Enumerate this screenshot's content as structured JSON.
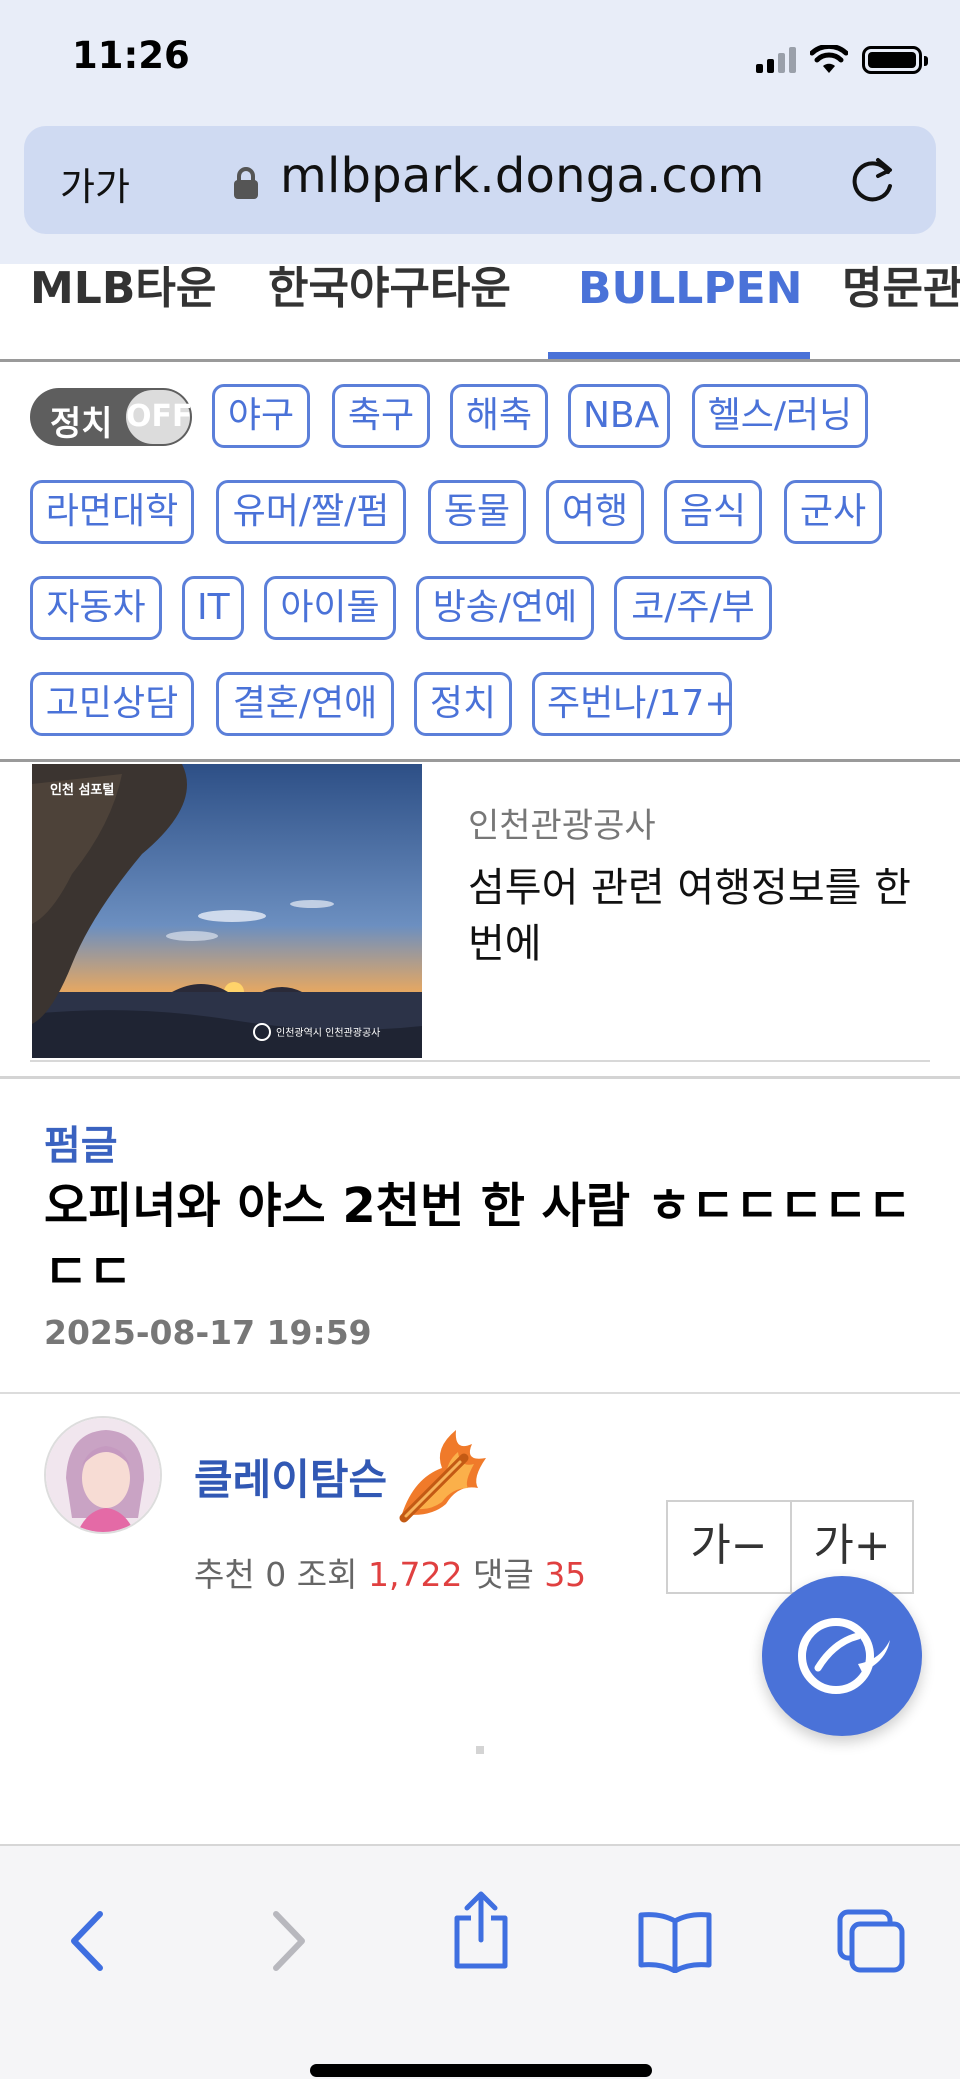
{
  "status_bar": {
    "time": "11:26"
  },
  "browser": {
    "text_size_label": "가가",
    "url": "mlbpark.donga.com"
  },
  "category_nav": {
    "items": [
      "MLB타운",
      "한국야구타운",
      "BULLPEN",
      "명문관"
    ],
    "active": "BULLPEN"
  },
  "filter": {
    "toggle_label": "정치",
    "toggle_state": "OFF",
    "tags": [
      "야구",
      "축구",
      "해축",
      "NBA",
      "헬스/러닝",
      "라면대학",
      "유머/짤/펌",
      "동물",
      "여행",
      "음식",
      "군사",
      "자동차",
      "IT",
      "아이돌",
      "방송/연예",
      "코/주/부",
      "고민상담",
      "결혼/연애",
      "정치",
      "주번나/17+"
    ]
  },
  "ad": {
    "image_badge": "인천 섬포털",
    "image_logos": "인천광역시  인천관광공사",
    "source": "인천관광공사",
    "text": "섬투어 관련 여행정보를 한번에"
  },
  "post": {
    "category": "펌글",
    "title": "오피녀와 야스 2천번 한 사람 ㅎㄷㄷㄷㄷㄷㄷㄷ",
    "date": "2025-08-17 19:59",
    "author": "클레이탐슨",
    "stats": {
      "recommend_label": "추천",
      "recommend_value": "0",
      "views_label": "조회",
      "views_value": "1,722",
      "comments_label": "댓글",
      "comments_value": "35"
    },
    "font_smaller": "가−",
    "font_larger": "가+"
  },
  "colors": {
    "accent": "#4a72d8",
    "author": "#3158b4",
    "count_red": "#e04040"
  },
  "icons": {
    "back": "chevron-left-icon",
    "forward": "chevron-right-icon",
    "share": "share-icon",
    "bookmarks": "book-icon",
    "tabs": "tabs-icon"
  }
}
